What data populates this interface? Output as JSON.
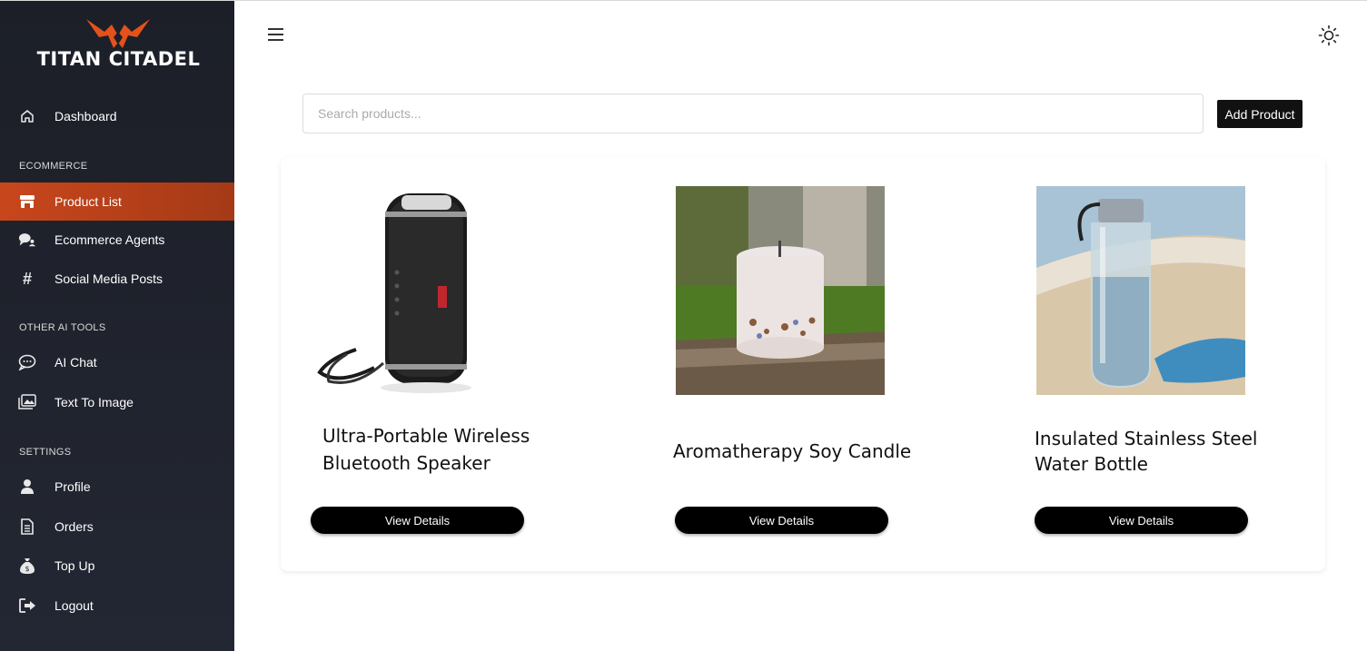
{
  "brand": {
    "name": "TITAN CITADEL",
    "accent": "#e4521c"
  },
  "sidebar": {
    "dashboard": {
      "label": "Dashboard",
      "icon": "home-icon"
    },
    "sections": {
      "ecommerce": "ECOMMERCE",
      "other_ai_tools": "OTHER AI TOOLS",
      "settings": "SETTINGS"
    },
    "ecommerce_items": [
      {
        "label": "Product List",
        "icon": "store-icon",
        "active": true
      },
      {
        "label": "Ecommerce Agents",
        "icon": "chat-users-icon"
      },
      {
        "label": "Social Media Posts",
        "icon": "hashtag-icon"
      }
    ],
    "ai_items": [
      {
        "label": "AI Chat",
        "icon": "chat-bubble-icon"
      },
      {
        "label": "Text To Image",
        "icon": "images-icon"
      }
    ],
    "settings_items": [
      {
        "label": "Profile",
        "icon": "user-icon"
      },
      {
        "label": "Orders",
        "icon": "document-icon"
      },
      {
        "label": "Top Up",
        "icon": "money-bag-icon"
      },
      {
        "label": "Logout",
        "icon": "logout-icon"
      }
    ]
  },
  "header": {
    "menu_icon": "hamburger-menu-icon",
    "theme_icon": "sun-icon"
  },
  "search": {
    "placeholder": "Search products...",
    "value": ""
  },
  "toolbar": {
    "add_label": "Add Product"
  },
  "products": [
    {
      "title": "Ultra-Portable Wireless Bluetooth Speaker",
      "button": "View Details",
      "image": "bluetooth-speaker-image"
    },
    {
      "title": "Aromatherapy Soy Candle",
      "button": "View Details",
      "image": "soy-candle-image"
    },
    {
      "title": "Insulated Stainless Steel Water Bottle",
      "button": "View Details",
      "image": "water-bottle-image"
    }
  ]
}
